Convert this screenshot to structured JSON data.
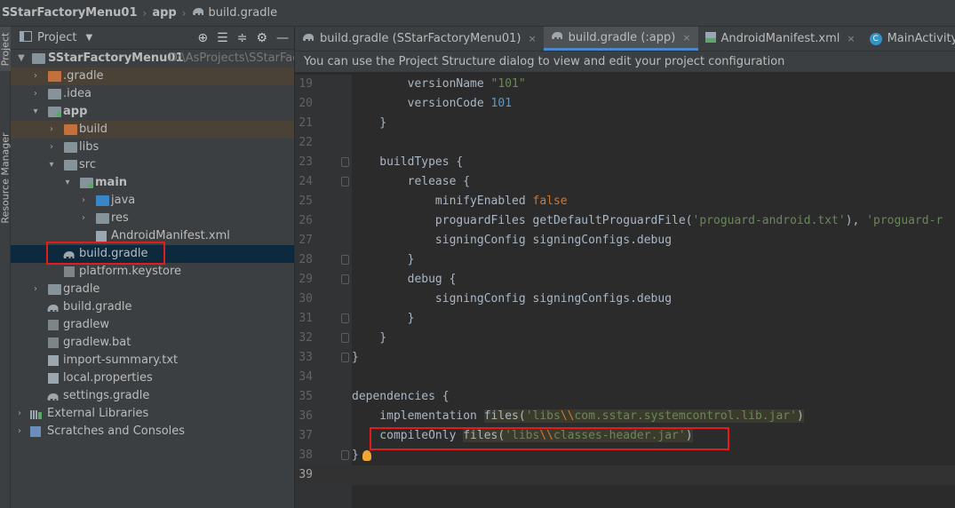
{
  "breadcrumb": {
    "items": [
      "SStarFactoryMenu01",
      "app",
      "build.gradle"
    ]
  },
  "toolstrip": {
    "project_tab": "Project",
    "resource_tab": "Resource Manager"
  },
  "project_panel": {
    "title": "Project",
    "tree": [
      {
        "label": "SStarFactoryMenu01",
        "path": "D:\\AsProjects\\SStarFactor",
        "bold": true
      },
      {
        "label": ".gradle"
      },
      {
        "label": ".idea"
      },
      {
        "label": "app",
        "bold": true
      },
      {
        "label": "build"
      },
      {
        "label": "libs"
      },
      {
        "label": "src"
      },
      {
        "label": "main",
        "bold": true
      },
      {
        "label": "java"
      },
      {
        "label": "res"
      },
      {
        "label": "AndroidManifest.xml"
      },
      {
        "label": "build.gradle"
      },
      {
        "label": "platform.keystore"
      },
      {
        "label": "gradle"
      },
      {
        "label": "build.gradle"
      },
      {
        "label": "gradlew"
      },
      {
        "label": "gradlew.bat"
      },
      {
        "label": "import-summary.txt"
      },
      {
        "label": "local.properties"
      },
      {
        "label": "settings.gradle"
      },
      {
        "label": "External Libraries"
      },
      {
        "label": "Scratches and Consoles"
      }
    ]
  },
  "editor": {
    "tabs": [
      {
        "label": "build.gradle (SStarFactoryMenu01)",
        "active": false
      },
      {
        "label": "build.gradle (:app)",
        "active": true
      },
      {
        "label": "AndroidManifest.xml",
        "active": false
      },
      {
        "label": "MainActivity.java",
        "active": false
      }
    ],
    "notice": "You can use the Project Structure dialog to view and edit your project configuration",
    "lines": [
      {
        "n": "19",
        "parts": [
          [
            "",
            "        versionName "
          ],
          [
            "str",
            "\"101\""
          ]
        ]
      },
      {
        "n": "20",
        "parts": [
          [
            "",
            "        versionCode "
          ],
          [
            "num-lit",
            "101"
          ]
        ]
      },
      {
        "n": "21",
        "parts": [
          [
            "",
            "    }"
          ]
        ]
      },
      {
        "n": "22",
        "parts": [
          [
            "",
            ""
          ]
        ]
      },
      {
        "n": "23",
        "parts": [
          [
            "",
            "    buildTypes {"
          ]
        ]
      },
      {
        "n": "24",
        "parts": [
          [
            "",
            "        release {"
          ]
        ]
      },
      {
        "n": "25",
        "parts": [
          [
            "",
            "            minifyEnabled "
          ],
          [
            "kw",
            "false"
          ]
        ]
      },
      {
        "n": "26",
        "parts": [
          [
            "",
            "            proguardFiles getDefaultProguardFile("
          ],
          [
            "str",
            "'proguard-android.txt'"
          ],
          [
            "",
            "), "
          ],
          [
            "str",
            "'proguard-r"
          ]
        ]
      },
      {
        "n": "27",
        "parts": [
          [
            "",
            "            signingConfig signingConfigs.debug"
          ]
        ]
      },
      {
        "n": "28",
        "parts": [
          [
            "",
            "        }"
          ]
        ]
      },
      {
        "n": "29",
        "parts": [
          [
            "",
            "        debug {"
          ]
        ]
      },
      {
        "n": "30",
        "parts": [
          [
            "",
            "            signingConfig signingConfigs.debug"
          ]
        ]
      },
      {
        "n": "31",
        "parts": [
          [
            "",
            "        }"
          ]
        ]
      },
      {
        "n": "32",
        "parts": [
          [
            "",
            "    }"
          ]
        ]
      },
      {
        "n": "33",
        "parts": [
          [
            "",
            "}"
          ]
        ]
      },
      {
        "n": "34",
        "parts": [
          [
            "",
            ""
          ]
        ]
      },
      {
        "n": "35",
        "parts": [
          [
            "",
            "dependencies {"
          ]
        ]
      },
      {
        "n": "36",
        "parts": [
          [
            "",
            "    implementation "
          ],
          [
            "hl",
            "files("
          ],
          [
            "hl str",
            "'libs"
          ],
          [
            "hl kw",
            "\\\\"
          ],
          [
            "hl str",
            "com.sstar.systemcontrol.lib.jar'"
          ],
          [
            "hl",
            ")"
          ]
        ]
      },
      {
        "n": "37",
        "parts": [
          [
            "",
            "    compileOnly "
          ],
          [
            "hl",
            "files("
          ],
          [
            "hl str",
            "'libs"
          ],
          [
            "hl kw",
            "\\\\"
          ],
          [
            "hl str",
            "classes-header.jar'"
          ],
          [
            "hl",
            ")"
          ]
        ]
      },
      {
        "n": "38",
        "parts": [
          [
            "",
            "}"
          ]
        ]
      },
      {
        "n": "39",
        "parts": [
          [
            "",
            ""
          ]
        ]
      }
    ]
  },
  "colors": {
    "accent": "#4a88c7",
    "annotation": "#e21b1b"
  }
}
